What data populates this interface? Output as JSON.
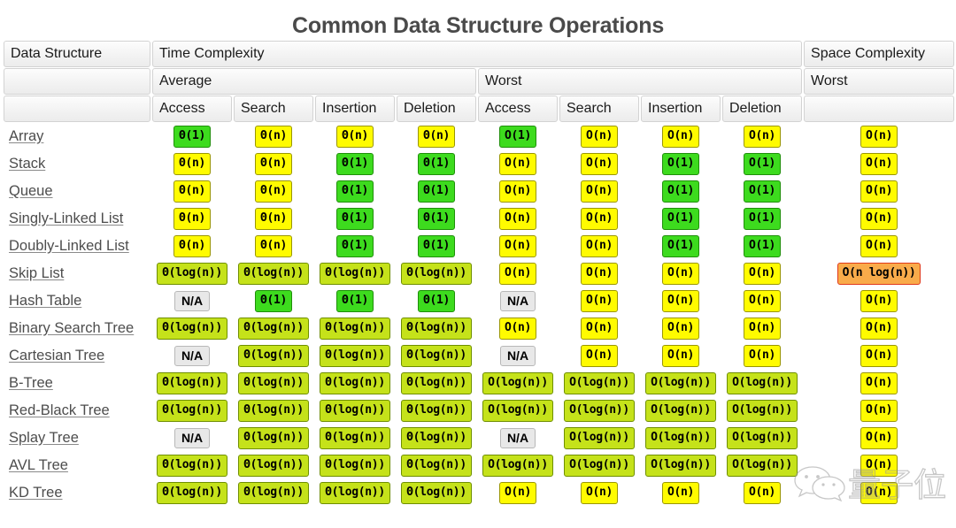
{
  "title": "Common Data Structure Operations",
  "header": {
    "row1": [
      {
        "label": "Data Structure",
        "colspan": 1
      },
      {
        "label": "Time Complexity",
        "colspan": 8
      },
      {
        "label": "Space Complexity",
        "colspan": 1
      }
    ],
    "row2": [
      {
        "label": "",
        "colspan": 1
      },
      {
        "label": "Average",
        "colspan": 4
      },
      {
        "label": "Worst",
        "colspan": 4
      },
      {
        "label": "Worst",
        "colspan": 1
      }
    ],
    "row3": [
      {
        "label": "",
        "colspan": 1
      },
      {
        "label": "Access",
        "colspan": 1
      },
      {
        "label": "Search",
        "colspan": 1
      },
      {
        "label": "Insertion",
        "colspan": 1
      },
      {
        "label": "Deletion",
        "colspan": 1
      },
      {
        "label": "Access",
        "colspan": 1
      },
      {
        "label": "Search",
        "colspan": 1
      },
      {
        "label": "Insertion",
        "colspan": 1
      },
      {
        "label": "Deletion",
        "colspan": 1
      },
      {
        "label": "",
        "colspan": 1
      }
    ]
  },
  "colors": {
    "yellow": "#fffb00",
    "lime": "#c5e21a",
    "green": "#3ddb1e",
    "orange": "#f9ab4a",
    "na": "#e8e8e8",
    "title_text": "#4a4a4a",
    "link_text": "#4d4d4d"
  },
  "watermark": {
    "icon": "wechat-icon",
    "text": "量子位"
  },
  "chart_data": {
    "type": "table",
    "title": "Common Data Structure Operations",
    "columns": [
      "Data Structure",
      "Average Access",
      "Average Search",
      "Average Insertion",
      "Average Deletion",
      "Worst Access",
      "Worst Search",
      "Worst Insertion",
      "Worst Deletion",
      "Worst Space"
    ],
    "rows": [
      {
        "name": "Array",
        "cells": [
          {
            "v": "Θ(1)",
            "c": "green"
          },
          {
            "v": "Θ(n)",
            "c": "yellow"
          },
          {
            "v": "Θ(n)",
            "c": "yellow"
          },
          {
            "v": "Θ(n)",
            "c": "yellow"
          },
          {
            "v": "O(1)",
            "c": "green"
          },
          {
            "v": "O(n)",
            "c": "yellow"
          },
          {
            "v": "O(n)",
            "c": "yellow"
          },
          {
            "v": "O(n)",
            "c": "yellow"
          },
          {
            "v": "O(n)",
            "c": "yellow"
          }
        ]
      },
      {
        "name": "Stack",
        "cells": [
          {
            "v": "Θ(n)",
            "c": "yellow"
          },
          {
            "v": "Θ(n)",
            "c": "yellow"
          },
          {
            "v": "Θ(1)",
            "c": "green"
          },
          {
            "v": "Θ(1)",
            "c": "green"
          },
          {
            "v": "O(n)",
            "c": "yellow"
          },
          {
            "v": "O(n)",
            "c": "yellow"
          },
          {
            "v": "O(1)",
            "c": "green"
          },
          {
            "v": "O(1)",
            "c": "green"
          },
          {
            "v": "O(n)",
            "c": "yellow"
          }
        ]
      },
      {
        "name": "Queue",
        "cells": [
          {
            "v": "Θ(n)",
            "c": "yellow"
          },
          {
            "v": "Θ(n)",
            "c": "yellow"
          },
          {
            "v": "Θ(1)",
            "c": "green"
          },
          {
            "v": "Θ(1)",
            "c": "green"
          },
          {
            "v": "O(n)",
            "c": "yellow"
          },
          {
            "v": "O(n)",
            "c": "yellow"
          },
          {
            "v": "O(1)",
            "c": "green"
          },
          {
            "v": "O(1)",
            "c": "green"
          },
          {
            "v": "O(n)",
            "c": "yellow"
          }
        ]
      },
      {
        "name": "Singly-Linked List",
        "cells": [
          {
            "v": "Θ(n)",
            "c": "yellow"
          },
          {
            "v": "Θ(n)",
            "c": "yellow"
          },
          {
            "v": "Θ(1)",
            "c": "green"
          },
          {
            "v": "Θ(1)",
            "c": "green"
          },
          {
            "v": "O(n)",
            "c": "yellow"
          },
          {
            "v": "O(n)",
            "c": "yellow"
          },
          {
            "v": "O(1)",
            "c": "green"
          },
          {
            "v": "O(1)",
            "c": "green"
          },
          {
            "v": "O(n)",
            "c": "yellow"
          }
        ]
      },
      {
        "name": "Doubly-Linked List",
        "cells": [
          {
            "v": "Θ(n)",
            "c": "yellow"
          },
          {
            "v": "Θ(n)",
            "c": "yellow"
          },
          {
            "v": "Θ(1)",
            "c": "green"
          },
          {
            "v": "Θ(1)",
            "c": "green"
          },
          {
            "v": "O(n)",
            "c": "yellow"
          },
          {
            "v": "O(n)",
            "c": "yellow"
          },
          {
            "v": "O(1)",
            "c": "green"
          },
          {
            "v": "O(1)",
            "c": "green"
          },
          {
            "v": "O(n)",
            "c": "yellow"
          }
        ]
      },
      {
        "name": "Skip List",
        "cells": [
          {
            "v": "Θ(log(n))",
            "c": "lime"
          },
          {
            "v": "Θ(log(n))",
            "c": "lime"
          },
          {
            "v": "Θ(log(n))",
            "c": "lime"
          },
          {
            "v": "Θ(log(n))",
            "c": "lime"
          },
          {
            "v": "O(n)",
            "c": "yellow"
          },
          {
            "v": "O(n)",
            "c": "yellow"
          },
          {
            "v": "O(n)",
            "c": "yellow"
          },
          {
            "v": "O(n)",
            "c": "yellow"
          },
          {
            "v": "O(n log(n))",
            "c": "orange"
          }
        ]
      },
      {
        "name": "Hash Table",
        "cells": [
          {
            "v": "N/A",
            "c": "na"
          },
          {
            "v": "Θ(1)",
            "c": "green"
          },
          {
            "v": "Θ(1)",
            "c": "green"
          },
          {
            "v": "Θ(1)",
            "c": "green"
          },
          {
            "v": "N/A",
            "c": "na"
          },
          {
            "v": "O(n)",
            "c": "yellow"
          },
          {
            "v": "O(n)",
            "c": "yellow"
          },
          {
            "v": "O(n)",
            "c": "yellow"
          },
          {
            "v": "O(n)",
            "c": "yellow"
          }
        ]
      },
      {
        "name": "Binary Search Tree",
        "cells": [
          {
            "v": "Θ(log(n))",
            "c": "lime"
          },
          {
            "v": "Θ(log(n))",
            "c": "lime"
          },
          {
            "v": "Θ(log(n))",
            "c": "lime"
          },
          {
            "v": "Θ(log(n))",
            "c": "lime"
          },
          {
            "v": "O(n)",
            "c": "yellow"
          },
          {
            "v": "O(n)",
            "c": "yellow"
          },
          {
            "v": "O(n)",
            "c": "yellow"
          },
          {
            "v": "O(n)",
            "c": "yellow"
          },
          {
            "v": "O(n)",
            "c": "yellow"
          }
        ]
      },
      {
        "name": "Cartesian Tree",
        "cells": [
          {
            "v": "N/A",
            "c": "na"
          },
          {
            "v": "Θ(log(n))",
            "c": "lime"
          },
          {
            "v": "Θ(log(n))",
            "c": "lime"
          },
          {
            "v": "Θ(log(n))",
            "c": "lime"
          },
          {
            "v": "N/A",
            "c": "na"
          },
          {
            "v": "O(n)",
            "c": "yellow"
          },
          {
            "v": "O(n)",
            "c": "yellow"
          },
          {
            "v": "O(n)",
            "c": "yellow"
          },
          {
            "v": "O(n)",
            "c": "yellow"
          }
        ]
      },
      {
        "name": "B-Tree",
        "cells": [
          {
            "v": "Θ(log(n))",
            "c": "lime"
          },
          {
            "v": "Θ(log(n))",
            "c": "lime"
          },
          {
            "v": "Θ(log(n))",
            "c": "lime"
          },
          {
            "v": "Θ(log(n))",
            "c": "lime"
          },
          {
            "v": "O(log(n))",
            "c": "lime"
          },
          {
            "v": "O(log(n))",
            "c": "lime"
          },
          {
            "v": "O(log(n))",
            "c": "lime"
          },
          {
            "v": "O(log(n))",
            "c": "lime"
          },
          {
            "v": "O(n)",
            "c": "yellow"
          }
        ]
      },
      {
        "name": "Red-Black Tree",
        "cells": [
          {
            "v": "Θ(log(n))",
            "c": "lime"
          },
          {
            "v": "Θ(log(n))",
            "c": "lime"
          },
          {
            "v": "Θ(log(n))",
            "c": "lime"
          },
          {
            "v": "Θ(log(n))",
            "c": "lime"
          },
          {
            "v": "O(log(n))",
            "c": "lime"
          },
          {
            "v": "O(log(n))",
            "c": "lime"
          },
          {
            "v": "O(log(n))",
            "c": "lime"
          },
          {
            "v": "O(log(n))",
            "c": "lime"
          },
          {
            "v": "O(n)",
            "c": "yellow"
          }
        ]
      },
      {
        "name": "Splay Tree",
        "cells": [
          {
            "v": "N/A",
            "c": "na"
          },
          {
            "v": "Θ(log(n))",
            "c": "lime"
          },
          {
            "v": "Θ(log(n))",
            "c": "lime"
          },
          {
            "v": "Θ(log(n))",
            "c": "lime"
          },
          {
            "v": "N/A",
            "c": "na"
          },
          {
            "v": "O(log(n))",
            "c": "lime"
          },
          {
            "v": "O(log(n))",
            "c": "lime"
          },
          {
            "v": "O(log(n))",
            "c": "lime"
          },
          {
            "v": "O(n)",
            "c": "yellow"
          }
        ]
      },
      {
        "name": "AVL Tree",
        "cells": [
          {
            "v": "Θ(log(n))",
            "c": "lime"
          },
          {
            "v": "Θ(log(n))",
            "c": "lime"
          },
          {
            "v": "Θ(log(n))",
            "c": "lime"
          },
          {
            "v": "Θ(log(n))",
            "c": "lime"
          },
          {
            "v": "O(log(n))",
            "c": "lime"
          },
          {
            "v": "O(log(n))",
            "c": "lime"
          },
          {
            "v": "O(log(n))",
            "c": "lime"
          },
          {
            "v": "O(log(n))",
            "c": "lime"
          },
          {
            "v": "O(n)",
            "c": "yellow"
          }
        ]
      },
      {
        "name": "KD Tree",
        "cells": [
          {
            "v": "Θ(log(n))",
            "c": "lime"
          },
          {
            "v": "Θ(log(n))",
            "c": "lime"
          },
          {
            "v": "Θ(log(n))",
            "c": "lime"
          },
          {
            "v": "Θ(log(n))",
            "c": "lime"
          },
          {
            "v": "O(n)",
            "c": "yellow"
          },
          {
            "v": "O(n)",
            "c": "yellow"
          },
          {
            "v": "O(n)",
            "c": "yellow"
          },
          {
            "v": "O(n)",
            "c": "yellow"
          },
          {
            "v": "O(n)",
            "c": "yellow"
          }
        ]
      }
    ]
  }
}
